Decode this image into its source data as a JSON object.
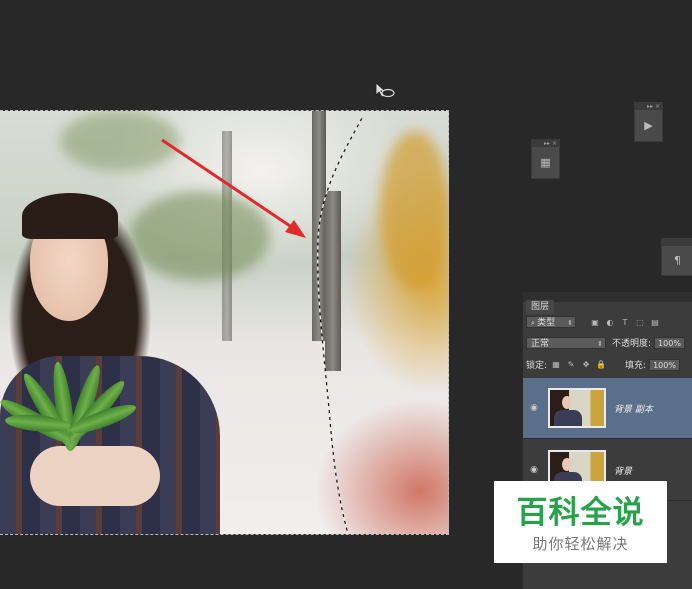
{
  "canvas": {
    "alt": "photo of girl holding bamboo leaves"
  },
  "mini_panels": [
    {
      "icon": "panel-icon",
      "glyph": "▦"
    },
    {
      "icon": "play-icon",
      "glyph": "▶"
    },
    {
      "icon": "paragraph-icon",
      "glyph": "¶"
    }
  ],
  "layers_panel": {
    "tab_label": "图层",
    "filter_label": "类型",
    "blend_mode": "正常",
    "opacity_label": "不透明度:",
    "opacity_value": "100%",
    "lock_label": "锁定:",
    "fill_label": "填充:",
    "fill_value": "100%",
    "layers": [
      {
        "name": "背景 副本",
        "selected": true
      },
      {
        "name": "背景",
        "selected": false
      }
    ]
  },
  "watermark": {
    "title": "百科全说",
    "subtitle": "助你轻松解决"
  },
  "colors": {
    "selected_layer": "#5b6e8a",
    "watermark_green": "#26a24a",
    "arrow_red": "#e02a2a"
  }
}
